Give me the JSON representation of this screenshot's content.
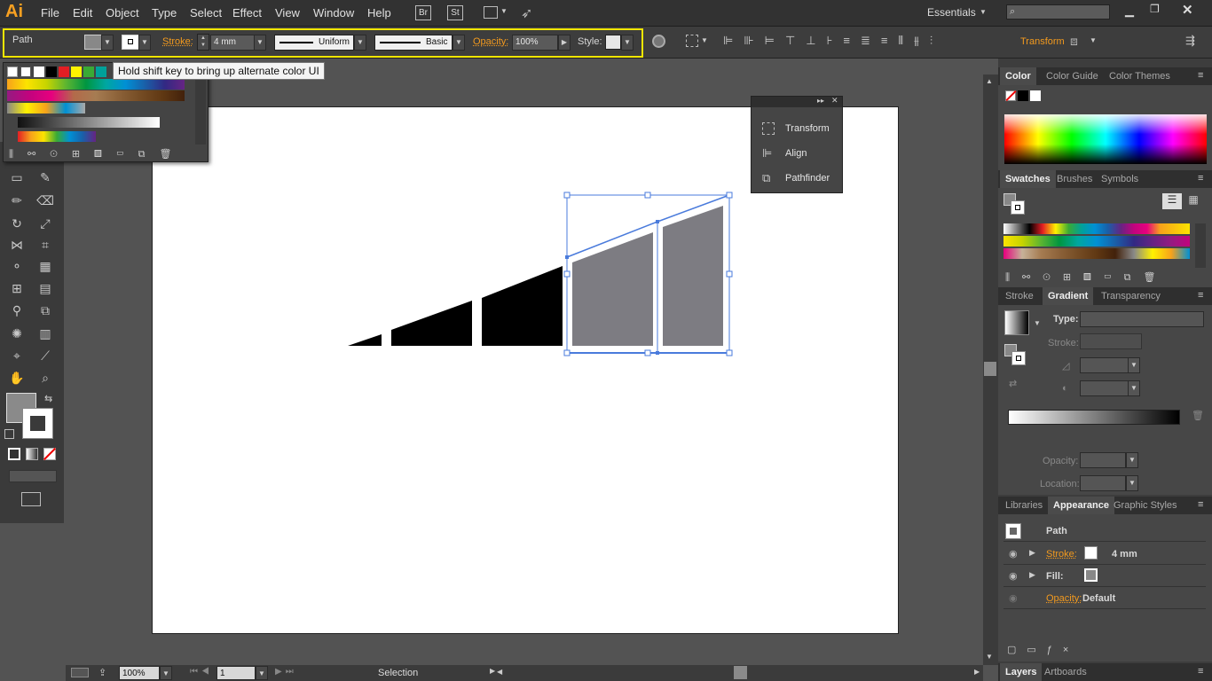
{
  "app": {
    "logo": "Ai",
    "menu": [
      "File",
      "Edit",
      "Object",
      "Type",
      "Select",
      "Effect",
      "View",
      "Window",
      "Help"
    ],
    "workspace": "Essentials",
    "bridge_label": "Br",
    "stock_label": "St"
  },
  "control_bar": {
    "object_type": "Path",
    "stroke_label": "Stroke:",
    "stroke_weight": "4 mm",
    "stroke_profile": "Uniform",
    "brush_definition": "Basic",
    "opacity_label": "Opacity:",
    "opacity_value": "100%",
    "style_label": "Style:",
    "transform_link": "Transform"
  },
  "tooltip": "Hold shift key to bring up alternate color UI",
  "floating_panel": {
    "items": [
      "Transform",
      "Align",
      "Pathfinder"
    ]
  },
  "right_panel": {
    "color_tabs": [
      "Color",
      "Color Guide",
      "Color Themes"
    ],
    "swatch_tabs": [
      "Swatches",
      "Brushes",
      "Symbols"
    ],
    "gradient_tabs": [
      "Stroke",
      "Gradient",
      "Transparency"
    ],
    "gradient": {
      "type_label": "Type:",
      "stroke_label": "Stroke:",
      "opacity_label": "Opacity:",
      "location_label": "Location:"
    },
    "appearance_tabs": [
      "Libraries",
      "Appearance",
      "Graphic Styles"
    ],
    "appearance": {
      "title": "Path",
      "stroke_label": "Stroke:",
      "stroke_value": "4 mm",
      "fill_label": "Fill:",
      "opacity_label": "Opacity:",
      "opacity_value": "Default"
    },
    "bottom_tabs": [
      "Layers",
      "Artboards"
    ]
  },
  "status": {
    "zoom": "100%",
    "artboard_number": "1",
    "tool": "Selection"
  },
  "colors": {
    "accent_orange": "#f39a1e",
    "selection_blue": "#4a7bdc",
    "highlight_yellow": "#f2e600",
    "shape_gray": "#7d7c82"
  }
}
